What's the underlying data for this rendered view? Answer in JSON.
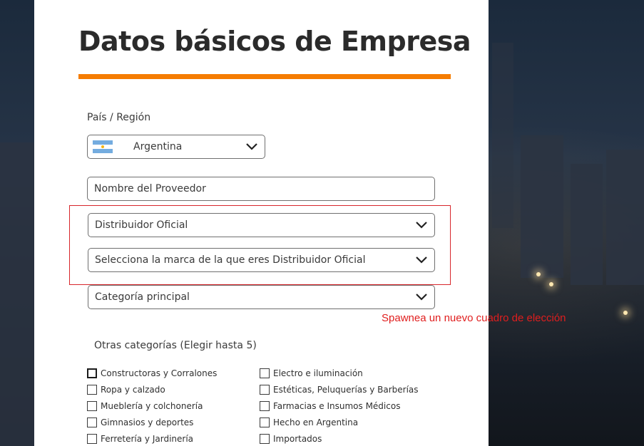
{
  "page": {
    "title": "Datos básicos de Empresa",
    "accent_color": "#f57c00",
    "annotation_color": "#e01e1e"
  },
  "country": {
    "label": "País / Región",
    "flag_icon": "argentina-flag-icon",
    "selected": "Argentina"
  },
  "supplier_name": {
    "placeholder": "Nombre del Proveedor"
  },
  "distributor": {
    "selected": "Distribuidor Oficial"
  },
  "brand": {
    "placeholder": "Selecciona la marca de la que eres Distribuidor Oficial"
  },
  "category": {
    "placeholder": "Categoría principal"
  },
  "annotation": {
    "text": "Spawnea un nuevo cuadro de elección"
  },
  "other_categories": {
    "label": "Otras categorías (Elegir hasta 5)",
    "left": [
      {
        "label": "Constructoras y Corralones",
        "checked": false
      },
      {
        "label": "Ropa y calzado",
        "checked": false
      },
      {
        "label": "Mueblería y colchonería",
        "checked": false
      },
      {
        "label": "Gimnasios y deportes",
        "checked": false
      },
      {
        "label": "Ferretería y Jardinería",
        "checked": false
      }
    ],
    "right": [
      {
        "label": "Electro e iluminación",
        "checked": false
      },
      {
        "label": "Estéticas, Peluquerías y Barberías",
        "checked": false
      },
      {
        "label": "Farmacias e Insumos Médicos",
        "checked": false
      },
      {
        "label": "Hecho en Argentina",
        "checked": false
      },
      {
        "label": "Importados",
        "checked": false
      }
    ]
  }
}
